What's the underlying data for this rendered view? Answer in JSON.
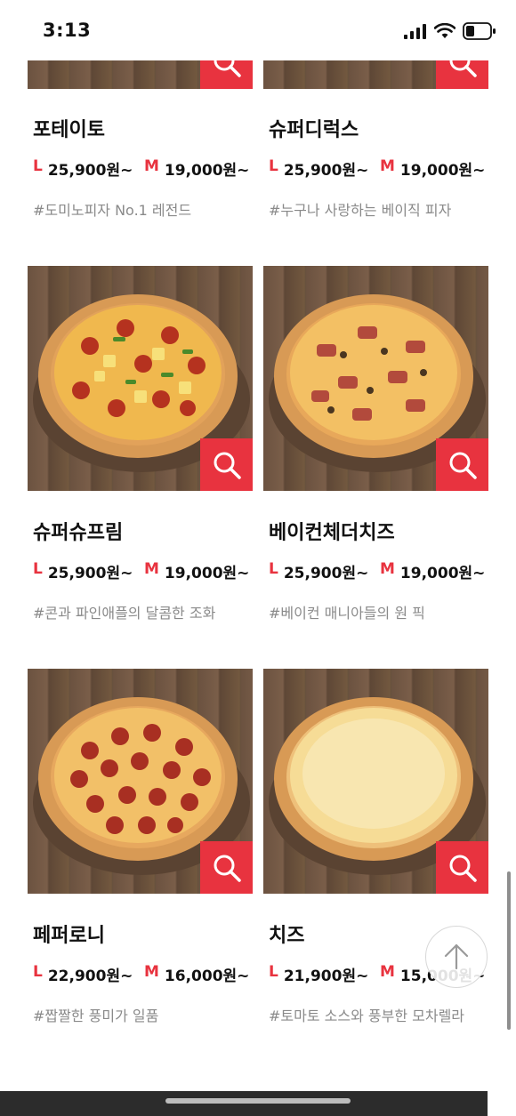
{
  "status_bar": {
    "time": "3:13"
  },
  "menu": [
    {
      "name": "포테이토",
      "large_size": "L",
      "large_price": "25,900원~",
      "medium_size": "M",
      "medium_price": "19,000원~",
      "desc": "#도미노피자 No.1 레전드"
    },
    {
      "name": "슈퍼디럭스",
      "large_size": "L",
      "large_price": "25,900원~",
      "medium_size": "M",
      "medium_price": "19,000원~",
      "desc": "#누구나 사랑하는 베이직 피자"
    },
    {
      "name": "슈퍼슈프림",
      "large_size": "L",
      "large_price": "25,900원~",
      "medium_size": "M",
      "medium_price": "19,000원~",
      "desc": "#콘과 파인애플의 달콤한 조화"
    },
    {
      "name": "베이컨체더치즈",
      "large_size": "L",
      "large_price": "25,900원~",
      "medium_size": "M",
      "medium_price": "19,000원~",
      "desc": "#베이컨 매니아들의 원 픽"
    },
    {
      "name": "페퍼로니",
      "large_size": "L",
      "large_price": "22,900원~",
      "medium_size": "M",
      "medium_price": "16,000원~",
      "desc": "#짭짤한 풍미가 일품"
    },
    {
      "name": "치즈",
      "large_size": "L",
      "large_price": "21,900원~",
      "medium_size": "M",
      "medium_price": "15,000원~",
      "desc": "#토마토 소스와 풍부한 모차렐라"
    }
  ],
  "icons": {
    "zoom": "magnifier-icon",
    "scroll_top": "arrow-up-icon"
  },
  "colors": {
    "accent": "#e8333f",
    "desc_text": "#8a8a8a"
  }
}
